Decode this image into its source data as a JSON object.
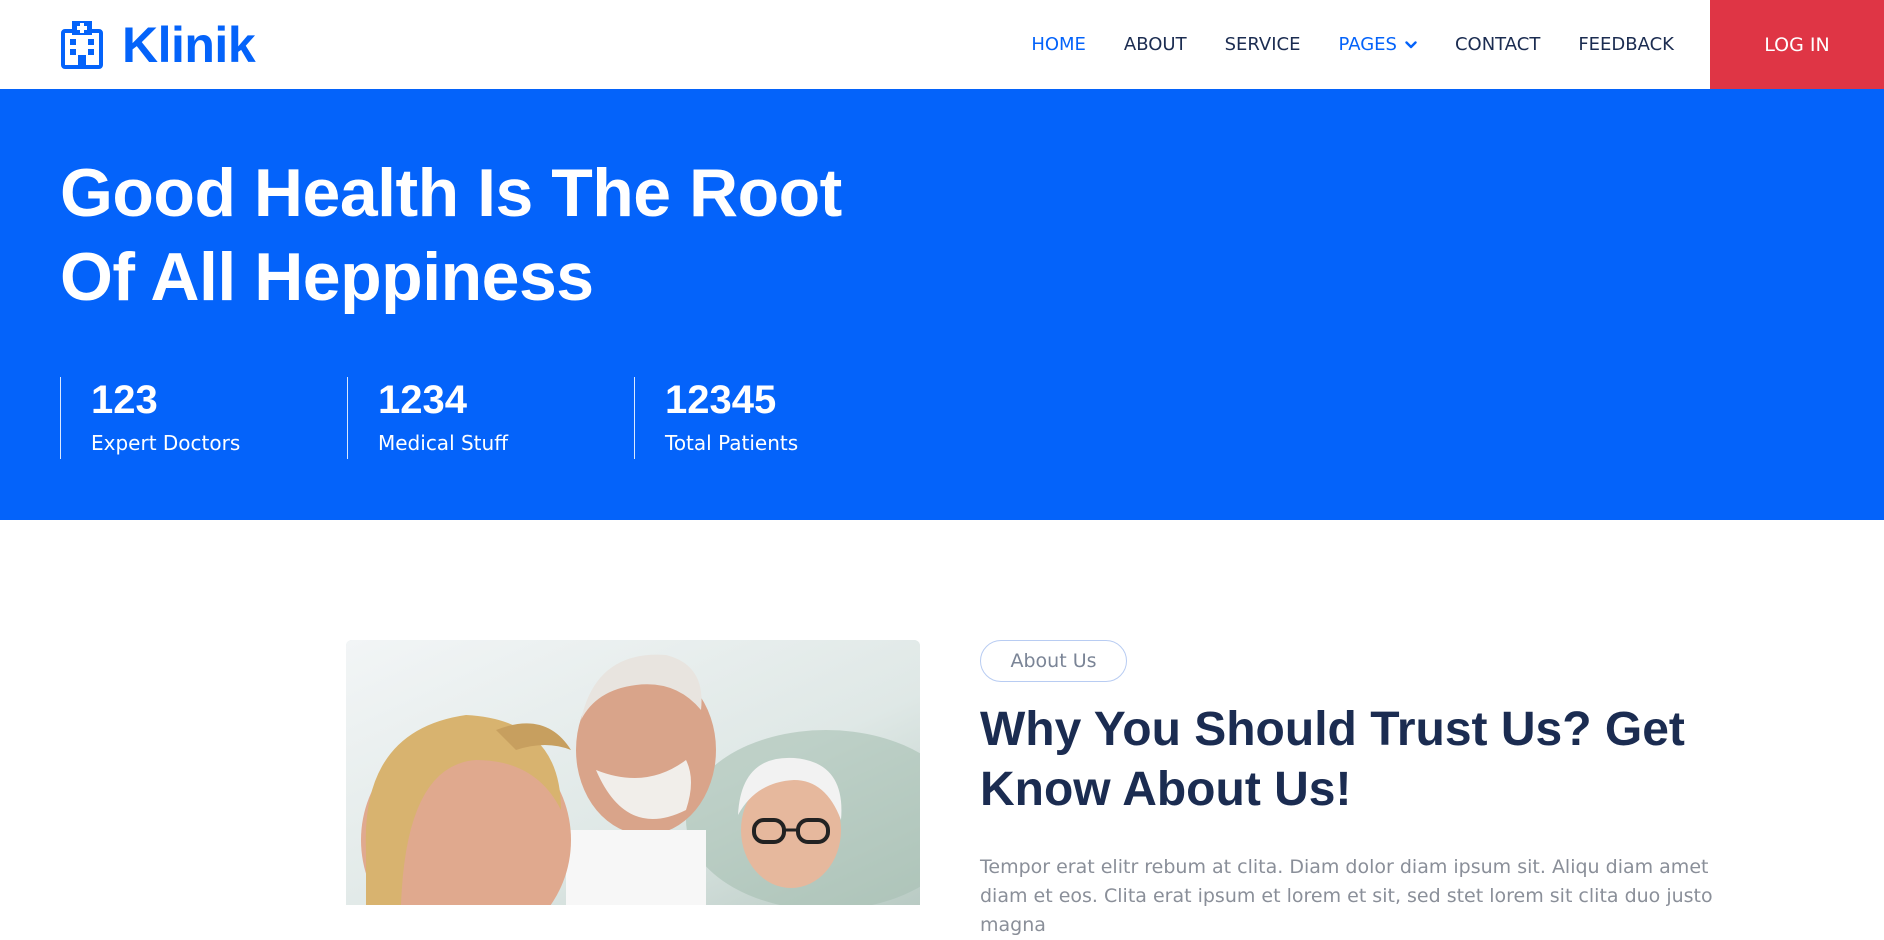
{
  "brand": {
    "name": "Klinik",
    "icon": "hospital-icon",
    "color": "#0463FA"
  },
  "nav": {
    "items": [
      {
        "label": "HOME",
        "active": true
      },
      {
        "label": "ABOUT",
        "active": false
      },
      {
        "label": "SERVICE",
        "active": false
      },
      {
        "label": "PAGES",
        "active": true,
        "dropdown": true
      },
      {
        "label": "CONTACT",
        "active": false
      },
      {
        "label": "FEEDBACK",
        "active": false
      }
    ],
    "login_label": "LOG IN",
    "login_color": "#DF3545"
  },
  "hero": {
    "title_line1": "Good Health Is The Root",
    "title_line2": "Of All Heppiness",
    "background": "#0463FA",
    "stats": [
      {
        "value": "123",
        "label": "Expert Doctors"
      },
      {
        "value": "1234",
        "label": "Medical Stuff"
      },
      {
        "value": "12345",
        "label": "Total Patients"
      }
    ]
  },
  "about": {
    "pill": "About Us",
    "title_line1": "Why You Should Trust Us? Get",
    "title_line2": "Know About Us!",
    "text": "Tempor erat elitr rebum at clita. Diam dolor diam ipsum sit. Aliqu diam amet diam et eos. Clita erat ipsum et lorem et sit, sed stet lorem sit clita duo justo magna"
  }
}
